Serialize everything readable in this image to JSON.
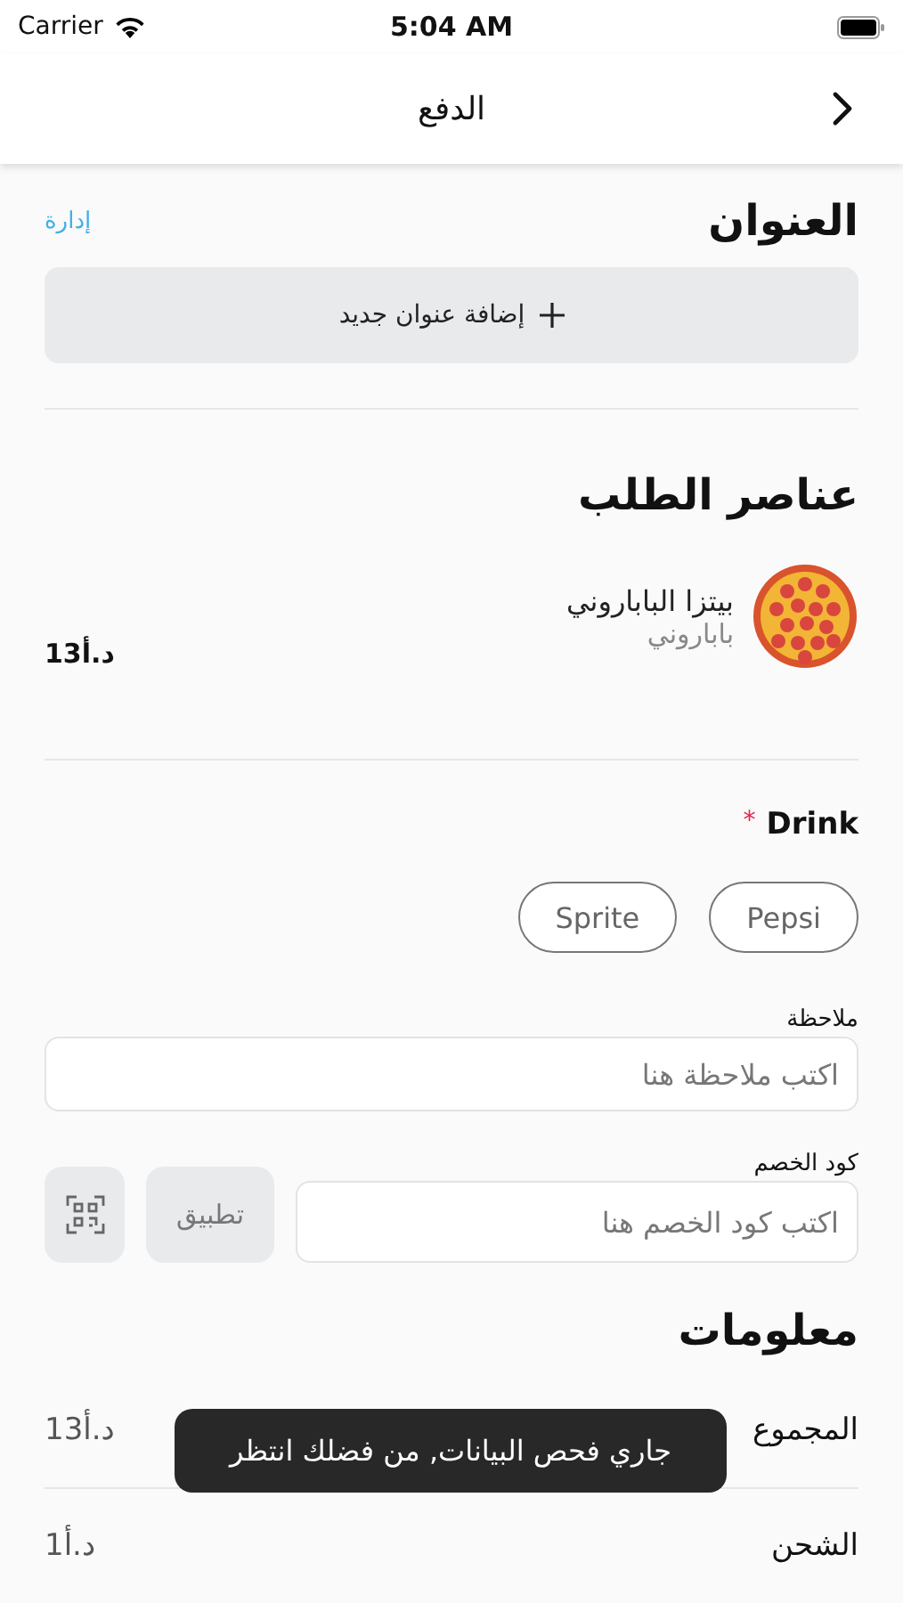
{
  "status_bar": {
    "carrier": "Carrier",
    "time": "5:04 AM"
  },
  "nav": {
    "title": "الدفع"
  },
  "address": {
    "title": "العنوان",
    "manage": "إدارة",
    "add_button": "إضافة عنوان جديد"
  },
  "order_items": {
    "title": "عناصر الطلب",
    "items": [
      {
        "name": "بيتزا الباباروني",
        "subtitle": "باباروني",
        "price": "د.أ13"
      }
    ]
  },
  "options": {
    "label": "Drink",
    "required_mark": "*",
    "choices": [
      {
        "label": "Pepsi",
        "selected": false
      },
      {
        "label": "Sprite",
        "selected": false
      }
    ]
  },
  "note": {
    "label": "ملاحظة",
    "placeholder": "اكتب ملاحظة هنا"
  },
  "discount": {
    "label": "كود الخصم",
    "placeholder": "اكتب كود الخصم هنا",
    "apply": "تطبيق"
  },
  "info": {
    "title": "معلومات",
    "rows": [
      {
        "label": "المجموع",
        "value": "د.أ13"
      },
      {
        "label": "الشحن",
        "value": "د.أ1"
      }
    ]
  },
  "toast": "جاري فحص البيانات, من فضلك انتظر"
}
